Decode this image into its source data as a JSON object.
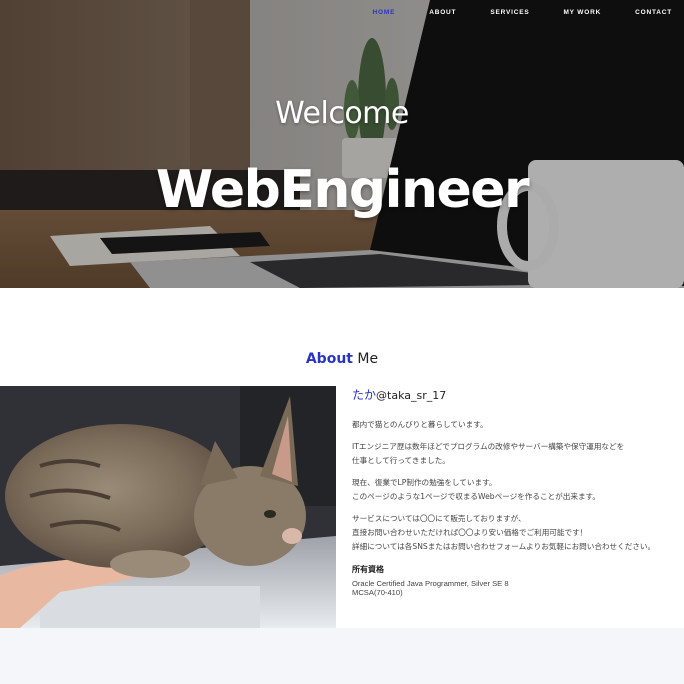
{
  "nav": {
    "items": [
      {
        "label": "HOME",
        "active": true
      },
      {
        "label": "ABOUT",
        "active": false
      },
      {
        "label": "SERVICES",
        "active": false
      },
      {
        "label": "MY WORK",
        "active": false
      },
      {
        "label": "CONTACT",
        "active": false
      }
    ]
  },
  "hero": {
    "welcome": "Welcome",
    "title": "WebEngineer"
  },
  "about": {
    "heading_accent": "About",
    "heading_rest": " Me",
    "name_accent": "たか",
    "name_handle": "@taka_sr_17",
    "paragraphs": [
      "都内で猫とのんびりと暮らしています。",
      "ITエンジニア歴は数年ほどでプログラムの改修やサーバー構築や保守運用などを\n仕事として行ってきました。",
      "現在、復業でLP制作の勉強をしています。\nこのページのような1ページで収まるWebページを作ることが出来ます。",
      "サービスについては〇〇にて販売しておりますが、\n直接お問い合わせいただければ〇〇より安い価格でご利用可能です！\n詳細については各SNSまたはお問い合わせフォームよりお気軽にお問い合わせください。"
    ],
    "qualifications_title": "所有資格",
    "qualifications": [
      "Oracle Certified Java Programmer, Silver SE 8",
      "MCSA(70-410)"
    ]
  },
  "colors": {
    "accent": "#2a33c4",
    "footer_band": "#f4f6f9"
  }
}
